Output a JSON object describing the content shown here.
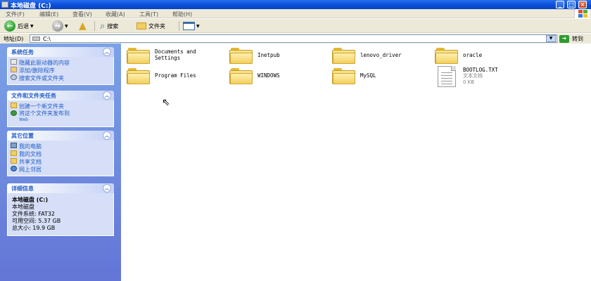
{
  "window": {
    "title": "本地磁盘 (C:)"
  },
  "menu": [
    "文件(F)",
    "编辑(E)",
    "查看(V)",
    "收藏(A)",
    "工具(T)",
    "帮助(H)"
  ],
  "toolbar": {
    "back": "后退",
    "search": "搜索",
    "folders": "文件夹"
  },
  "address": {
    "label": "地址(D)",
    "value": "C:\\",
    "go": "转到"
  },
  "tasks": [
    {
      "title": "系统任务",
      "items": [
        "隐藏此驱动器的内容",
        "添加/删除程序",
        "搜索文件或文件夹"
      ]
    },
    {
      "title": "文件和文件夹任务",
      "items": [
        "创建一个新文件夹",
        "将这个文件夹发布到",
        "Web"
      ]
    },
    {
      "title": "其它位置",
      "items": [
        "我的电脑",
        "我的文档",
        "共享文档",
        "网上邻居"
      ]
    }
  ],
  "details": {
    "title": "详细信息",
    "name": "本地磁盘 (C:)",
    "type": "本地磁盘",
    "fs": "文件系统: FAT32",
    "free": "可用空间: 5.37 GB",
    "total": "总大小: 19.9 GB"
  },
  "items": [
    {
      "name": "Documents and",
      "name2": "Settings",
      "kind": "folder"
    },
    {
      "name": "Inetpub",
      "kind": "folder"
    },
    {
      "name": "lenovo_driver",
      "kind": "folder"
    },
    {
      "name": "oracle",
      "kind": "folder"
    },
    {
      "name": "Program Files",
      "kind": "folder"
    },
    {
      "name": "WINDOWS",
      "kind": "folder"
    },
    {
      "name": "MySQL",
      "kind": "folder"
    },
    {
      "name": "BOOTLOG.TXT",
      "kind": "file",
      "type": "文本文档",
      "size": "0 KB"
    }
  ],
  "colors": {
    "titlebar": "#0a4fd8",
    "taskpane": "#6f8bdc",
    "link": "#215dc6"
  }
}
